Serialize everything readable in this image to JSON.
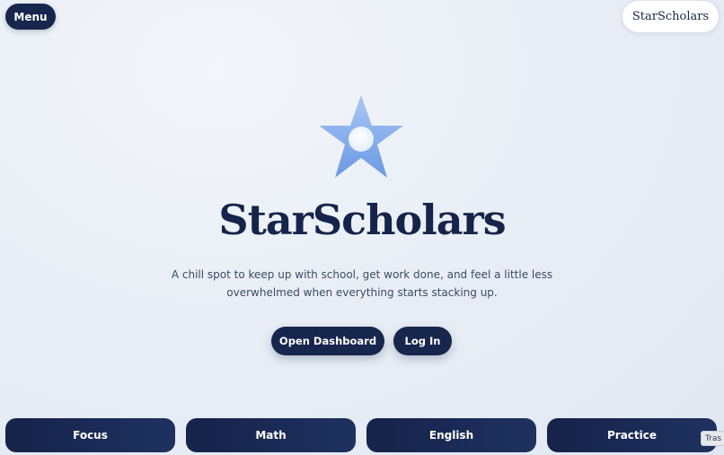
{
  "header": {
    "menu_label": "Menu",
    "brand_label": "StarScholars"
  },
  "hero": {
    "logo_icon": "star-icon",
    "title": "StarScholars",
    "tagline_line1": "A chill spot to keep up with school, get work done, and feel a little less",
    "tagline_line2": "overwhelmed when everything starts stacking up.",
    "primary_button": "Open Dashboard",
    "secondary_button": "Log In"
  },
  "bottom_nav": {
    "items": [
      {
        "label": "Focus"
      },
      {
        "label": "Math"
      },
      {
        "label": "English"
      },
      {
        "label": "Practice"
      }
    ]
  },
  "corner_tab": {
    "label": "Tras"
  },
  "colors": {
    "navy": "#17264c",
    "star_light": "#b9d3f7",
    "star_dark": "#6e9be6",
    "background": "#e9eef6"
  }
}
